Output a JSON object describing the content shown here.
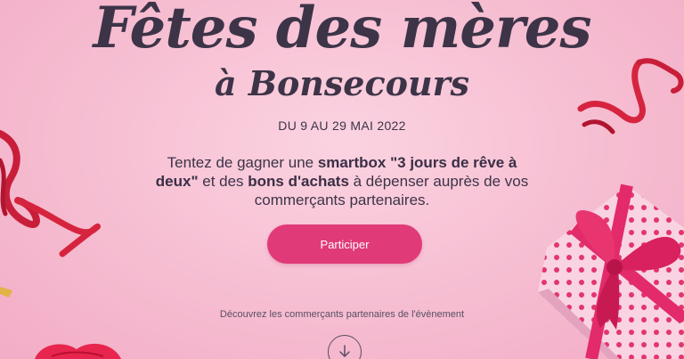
{
  "hero": {
    "title": "Fêtes des mères",
    "subtitle": "à Bonsecours",
    "dates": "DU 9 AU 29 MAI 2022",
    "description_parts": {
      "p1": "Tentez de gagner une ",
      "b1": "smartbox \"3 jours de rêve à deux\"",
      "p2": " et des ",
      "b2": "bons d'achats",
      "p3": " à dépenser auprès de vos commerçants partenaires."
    },
    "participate_label": "Participer",
    "discover_label": "Découvrez les commerçants partenaires de l'évènement"
  },
  "colors": {
    "background": "#f6bdd1",
    "accent": "#e03a78",
    "title_text": "#3d3448",
    "ribbon": "#d6243f",
    "gift_box": "#f7c6d8",
    "gift_ribbon": "#e32a6a"
  },
  "icons": {
    "scroll": "arrow-down-icon"
  }
}
